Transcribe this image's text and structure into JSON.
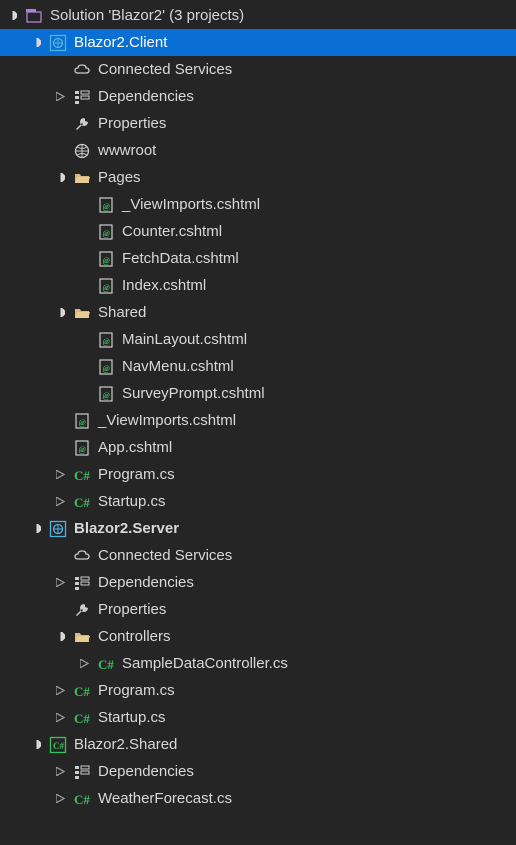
{
  "solution": {
    "label": "Solution 'Blazor2' (3 projects)"
  },
  "projects": [
    {
      "name": "Blazor2.Client",
      "bold": false,
      "selected": true,
      "icon": "globe-project",
      "expanded": true,
      "children": [
        {
          "label": "Connected Services",
          "icon": "cloud",
          "expander": "none"
        },
        {
          "label": "Dependencies",
          "icon": "references",
          "expander": "collapsed"
        },
        {
          "label": "Properties",
          "icon": "wrench",
          "expander": "none"
        },
        {
          "label": "wwwroot",
          "icon": "globe",
          "expander": "none"
        },
        {
          "label": "Pages",
          "icon": "folder-open",
          "expander": "expanded",
          "children": [
            {
              "label": "_ViewImports.cshtml",
              "icon": "cshtml"
            },
            {
              "label": "Counter.cshtml",
              "icon": "cshtml"
            },
            {
              "label": "FetchData.cshtml",
              "icon": "cshtml"
            },
            {
              "label": "Index.cshtml",
              "icon": "cshtml"
            }
          ]
        },
        {
          "label": "Shared",
          "icon": "folder-open",
          "expander": "expanded",
          "children": [
            {
              "label": "MainLayout.cshtml",
              "icon": "cshtml"
            },
            {
              "label": "NavMenu.cshtml",
              "icon": "cshtml"
            },
            {
              "label": "SurveyPrompt.cshtml",
              "icon": "cshtml"
            }
          ]
        },
        {
          "label": "_ViewImports.cshtml",
          "icon": "cshtml",
          "expander": "none"
        },
        {
          "label": "App.cshtml",
          "icon": "cshtml",
          "expander": "none"
        },
        {
          "label": "Program.cs",
          "icon": "csharp",
          "expander": "collapsed"
        },
        {
          "label": "Startup.cs",
          "icon": "csharp",
          "expander": "collapsed"
        }
      ]
    },
    {
      "name": "Blazor2.Server",
      "bold": true,
      "icon": "globe-project",
      "expanded": true,
      "children": [
        {
          "label": "Connected Services",
          "icon": "cloud",
          "expander": "none"
        },
        {
          "label": "Dependencies",
          "icon": "references",
          "expander": "collapsed"
        },
        {
          "label": "Properties",
          "icon": "wrench",
          "expander": "none"
        },
        {
          "label": "Controllers",
          "icon": "folder-open",
          "expander": "expanded",
          "children": [
            {
              "label": "SampleDataController.cs",
              "icon": "csharp",
              "expander": "collapsed"
            }
          ]
        },
        {
          "label": "Program.cs",
          "icon": "csharp",
          "expander": "collapsed"
        },
        {
          "label": "Startup.cs",
          "icon": "csharp",
          "expander": "collapsed"
        }
      ]
    },
    {
      "name": "Blazor2.Shared",
      "bold": false,
      "icon": "csharp-project",
      "expanded": true,
      "children": [
        {
          "label": "Dependencies",
          "icon": "references",
          "expander": "collapsed"
        },
        {
          "label": "WeatherForecast.cs",
          "icon": "csharp",
          "expander": "collapsed"
        }
      ]
    }
  ]
}
